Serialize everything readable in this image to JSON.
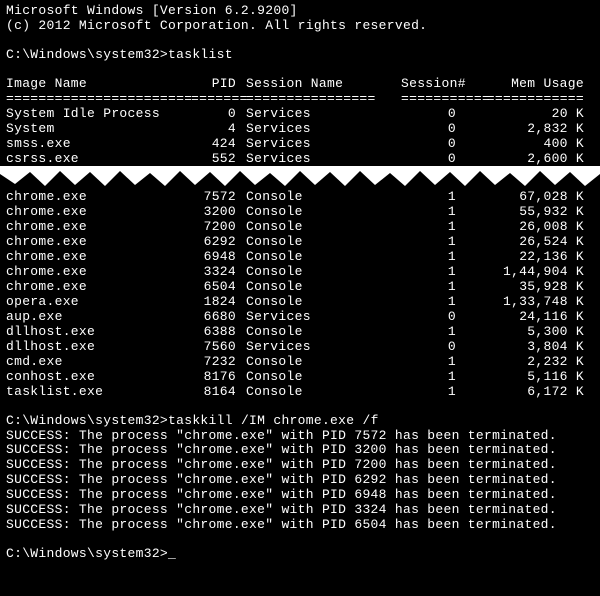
{
  "header": {
    "line1": "Microsoft Windows [Version 6.2.9200]",
    "line2": "(c) 2012 Microsoft Corporation. All rights reserved."
  },
  "prompt_path": "C:\\Windows\\system32>",
  "commands": {
    "tasklist": "tasklist",
    "taskkill": "taskkill /IM chrome.exe /f",
    "final": ""
  },
  "columns": {
    "image_name": "Image Name",
    "pid": "PID",
    "session_name": "Session Name",
    "session_num": "Session#",
    "mem_usage": "Mem Usage"
  },
  "rules": {
    "r1": "=========================",
    "r2": "=======",
    "r3": "================",
    "r4": "===========",
    "r5": "============"
  },
  "tasks_top": [
    {
      "name": "System Idle Process",
      "pid": "0",
      "sess": "Services",
      "snum": "0",
      "mem": "20 K"
    },
    {
      "name": "System",
      "pid": "4",
      "sess": "Services",
      "snum": "0",
      "mem": "2,832 K"
    },
    {
      "name": "smss.exe",
      "pid": "424",
      "sess": "Services",
      "snum": "0",
      "mem": "400 K"
    },
    {
      "name": "csrss.exe",
      "pid": "552",
      "sess": "Services",
      "snum": "0",
      "mem": "2,600 K"
    }
  ],
  "tasks_bottom": [
    {
      "name": "chrome.exe",
      "pid": "7572",
      "sess": "Console",
      "snum": "1",
      "mem": "67,028 K"
    },
    {
      "name": "chrome.exe",
      "pid": "3200",
      "sess": "Console",
      "snum": "1",
      "mem": "55,932 K"
    },
    {
      "name": "chrome.exe",
      "pid": "7200",
      "sess": "Console",
      "snum": "1",
      "mem": "26,008 K"
    },
    {
      "name": "chrome.exe",
      "pid": "6292",
      "sess": "Console",
      "snum": "1",
      "mem": "26,524 K"
    },
    {
      "name": "chrome.exe",
      "pid": "6948",
      "sess": "Console",
      "snum": "1",
      "mem": "22,136 K"
    },
    {
      "name": "chrome.exe",
      "pid": "3324",
      "sess": "Console",
      "snum": "1",
      "mem": "1,44,904 K"
    },
    {
      "name": "chrome.exe",
      "pid": "6504",
      "sess": "Console",
      "snum": "1",
      "mem": "35,928 K"
    },
    {
      "name": "opera.exe",
      "pid": "1824",
      "sess": "Console",
      "snum": "1",
      "mem": "1,33,748 K"
    },
    {
      "name": "aup.exe",
      "pid": "6680",
      "sess": "Services",
      "snum": "0",
      "mem": "24,116 K"
    },
    {
      "name": "dllhost.exe",
      "pid": "6388",
      "sess": "Console",
      "snum": "1",
      "mem": "5,300 K"
    },
    {
      "name": "dllhost.exe",
      "pid": "7560",
      "sess": "Services",
      "snum": "0",
      "mem": "3,804 K"
    },
    {
      "name": "cmd.exe",
      "pid": "7232",
      "sess": "Console",
      "snum": "1",
      "mem": "2,232 K"
    },
    {
      "name": "conhost.exe",
      "pid": "8176",
      "sess": "Console",
      "snum": "1",
      "mem": "5,116 K"
    },
    {
      "name": "tasklist.exe",
      "pid": "8164",
      "sess": "Console",
      "snum": "1",
      "mem": "6,172 K"
    }
  ],
  "kill_results": [
    "SUCCESS: The process \"chrome.exe\" with PID 7572 has been terminated.",
    "SUCCESS: The process \"chrome.exe\" with PID 3200 has been terminated.",
    "SUCCESS: The process \"chrome.exe\" with PID 7200 has been terminated.",
    "SUCCESS: The process \"chrome.exe\" with PID 6292 has been terminated.",
    "SUCCESS: The process \"chrome.exe\" with PID 6948 has been terminated.",
    "SUCCESS: The process \"chrome.exe\" with PID 3324 has been terminated.",
    "SUCCESS: The process \"chrome.exe\" with PID 6504 has been terminated."
  ]
}
